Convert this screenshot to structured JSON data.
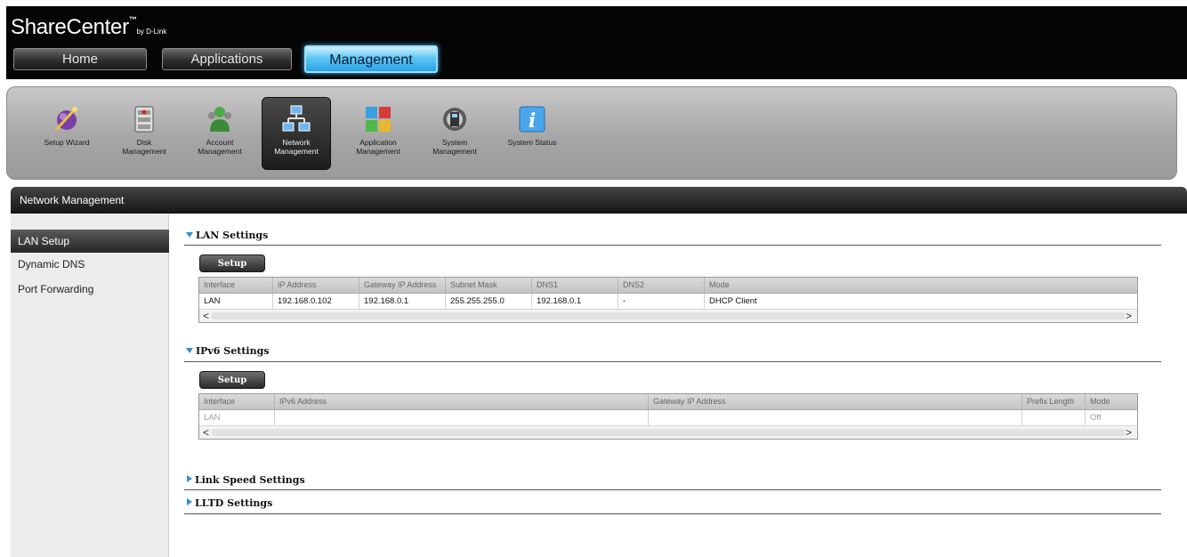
{
  "header": {
    "brand": "ShareCenter",
    "brand_tm": "™",
    "brand_by": "by D-Link",
    "tabs": [
      {
        "label": "Home"
      },
      {
        "label": "Applications"
      },
      {
        "label": "Management"
      }
    ],
    "active_tab": "Management"
  },
  "toolbar": {
    "items": [
      {
        "label": "Setup Wizard",
        "icon": "wizard-icon"
      },
      {
        "label": "Disk\nManagement",
        "icon": "disk-icon"
      },
      {
        "label": "Account\nManagement",
        "icon": "account-icon"
      },
      {
        "label": "Network\nManagement",
        "icon": "network-icon"
      },
      {
        "label": "Application\nManagement",
        "icon": "application-icon"
      },
      {
        "label": "System\nManagement",
        "icon": "system-icon"
      },
      {
        "label": "System Status",
        "icon": "info-icon"
      }
    ],
    "active_item": "Network Management"
  },
  "panel": {
    "title": "Network Management"
  },
  "sidebar": {
    "items": [
      {
        "label": "LAN Setup"
      },
      {
        "label": "Dynamic DNS"
      },
      {
        "label": "Port Forwarding"
      }
    ],
    "active_item": "LAN Setup"
  },
  "lan": {
    "title": "LAN Settings",
    "setup_label": "Setup",
    "columns": [
      "Interface",
      "IP Address",
      "Gateway IP Address",
      "Subnet Mask",
      "DNS1",
      "DNS2",
      "Mode"
    ],
    "rows": [
      [
        "LAN",
        "192.168.0.102",
        "192.168.0.1",
        "255.255.255.0",
        "192.168.0.1",
        "-",
        "DHCP Client"
      ]
    ]
  },
  "ipv6": {
    "title": "IPv6 Settings",
    "setup_label": "Setup",
    "columns": [
      "Interface",
      "IPv6 Address",
      "Gateway IP Address",
      "Prefix Length",
      "Mode"
    ],
    "rows": [
      [
        "LAN",
        "",
        "",
        "",
        "Off"
      ]
    ]
  },
  "link_speed": {
    "title": "Link Speed Settings"
  },
  "lltd": {
    "title": "LLTD Settings"
  },
  "scroll": {
    "left_arrow": "<",
    "right_arrow": ">"
  },
  "colors": {
    "active_tab": "#5fc7f4",
    "section_triangle": "#2e8fd6",
    "header_bg": "#050505"
  }
}
